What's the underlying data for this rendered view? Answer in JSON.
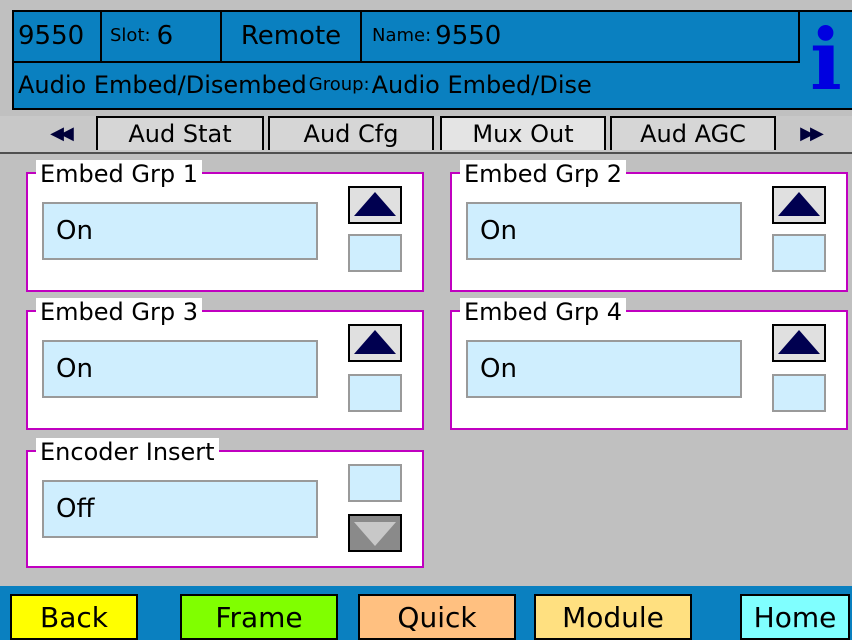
{
  "header": {
    "id": "9550",
    "slot_label": "Slot:",
    "slot_value": "6",
    "mode": "Remote",
    "name_label": "Name:",
    "name_value": "9550",
    "module_title": "Audio Embed/Disembed",
    "group_label": "Group:",
    "group_value": "Audio Embed/Dise",
    "info_icon": "i"
  },
  "tabs": {
    "prev_icon": "◀◀",
    "next_icon": "▶▶",
    "items": [
      "Aud Stat",
      "Aud Cfg",
      "Mux Out",
      "Aud AGC"
    ]
  },
  "panels": [
    {
      "title": "Embed Grp 1",
      "value": "On"
    },
    {
      "title": "Embed Grp 2",
      "value": "On"
    },
    {
      "title": "Embed Grp 3",
      "value": "On"
    },
    {
      "title": "Embed Grp 4",
      "value": "On"
    },
    {
      "title": "Encoder Insert",
      "value": "Off"
    }
  ],
  "footer": {
    "back": "Back",
    "frame": "Frame",
    "quick": "Quick",
    "module": "Module",
    "home": "Home"
  },
  "colors": {
    "header_bg": "#0a80c0",
    "panel_border": "#c000c0",
    "value_bg": "#cfeefe",
    "back": "#ffff00",
    "frame": "#80ff00",
    "quick": "#ffc080",
    "module": "#ffe080",
    "home": "#80ffff"
  }
}
